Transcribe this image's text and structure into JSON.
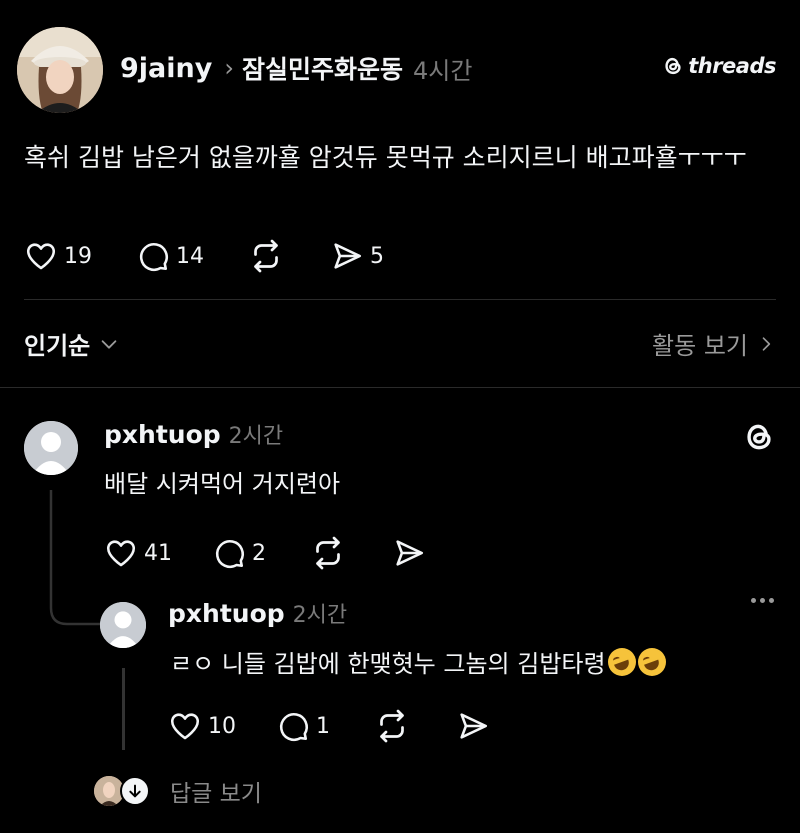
{
  "post": {
    "username": "9jainy",
    "community": "잠실민주화운동",
    "time": "4시간",
    "brand": "threads",
    "text": "혹쉬 김밥 남은거 없을까횰 암것듀 못먹규 소리지르니 배고파횰ㅜㅜㅜ",
    "likes": "19",
    "comments": "14",
    "shares": "5"
  },
  "sort": {
    "label": "인기순",
    "activity_label": "활동 보기"
  },
  "comments": [
    {
      "username": "pxhtuop",
      "time": "2시간",
      "text": "배달 시켜먹어 거지련아",
      "likes": "41",
      "replies": "2"
    },
    {
      "username": "pxhtuop",
      "time": "2시간",
      "text": "ㄹㅇ 니들 김밥에 한맺혓누 그놈의 김밥타령",
      "likes": "10",
      "replies": "1"
    }
  ],
  "view_replies_label": "답글 보기",
  "icons": {
    "like": "heart-icon",
    "comment": "comment-bubble-icon",
    "repost": "repost-icon",
    "share": "send-icon",
    "threads": "threads-logo-icon",
    "more": "more-dots-icon"
  }
}
